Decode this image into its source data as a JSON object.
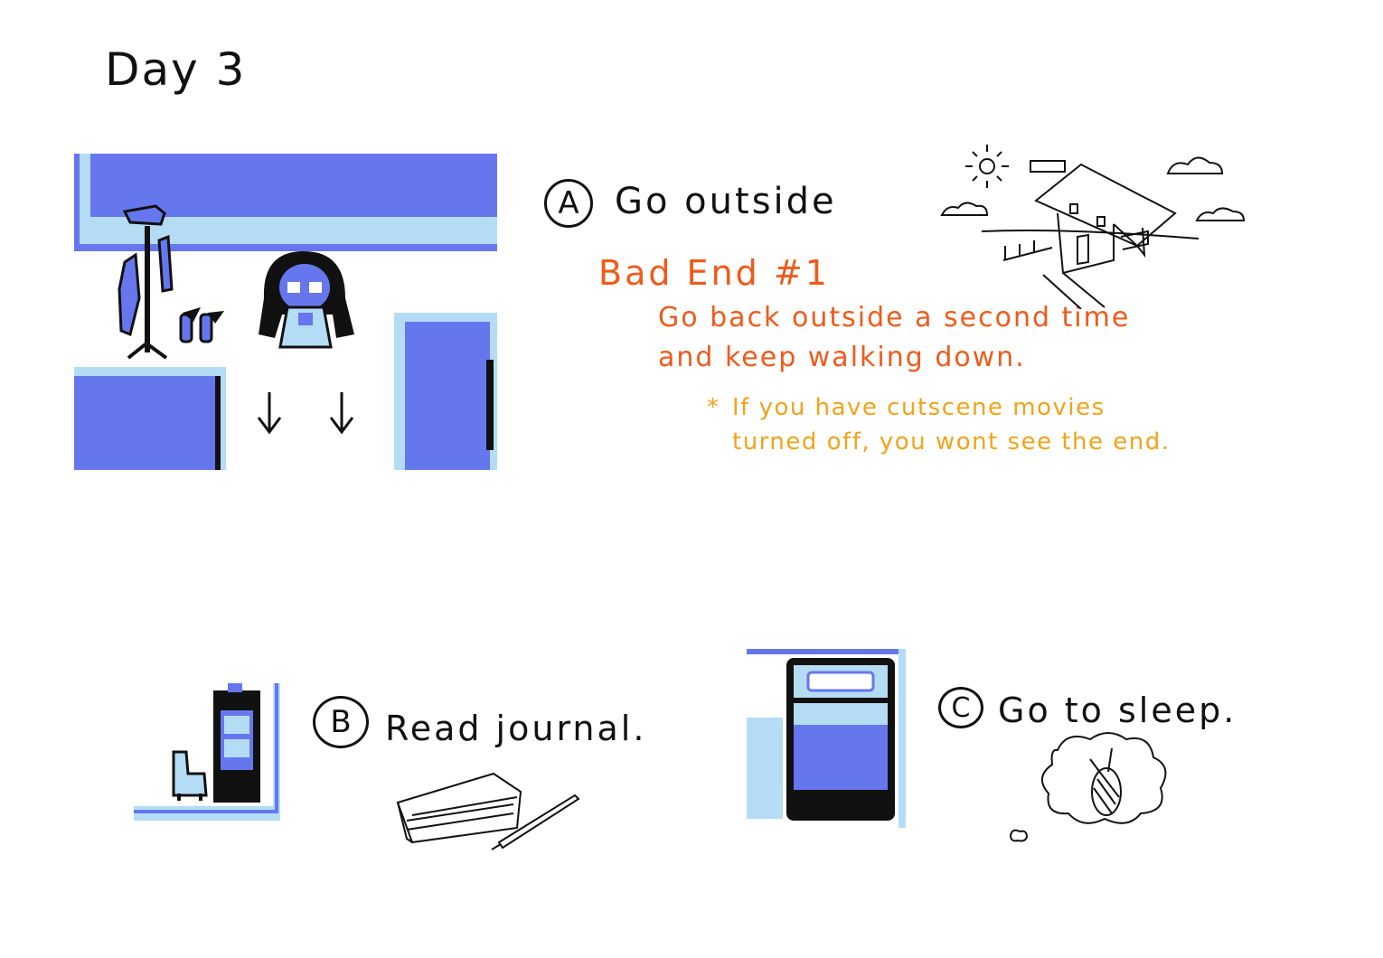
{
  "header": {
    "day_title": "Day 3"
  },
  "option_a": {
    "letter": "A",
    "label": "Go outside",
    "bad_end_title": "Bad End #1",
    "bad_end_line1": "Go back outside a second time",
    "bad_end_line2": "and keep walking down.",
    "note_star": "*",
    "note_line1": "If you have  cutscene movies",
    "note_line2": "turned off, you wont see the end."
  },
  "option_b": {
    "letter": "B",
    "label": "Read journal."
  },
  "option_c": {
    "letter": "C",
    "label": "Go to sleep."
  },
  "colors": {
    "game_dark": "#111111",
    "game_blue": "#6677ee",
    "game_light": "#b4dcf4",
    "game_white": "#ffffff",
    "bad_end_red": "#f05a1a",
    "note_orange": "#f2a318"
  }
}
